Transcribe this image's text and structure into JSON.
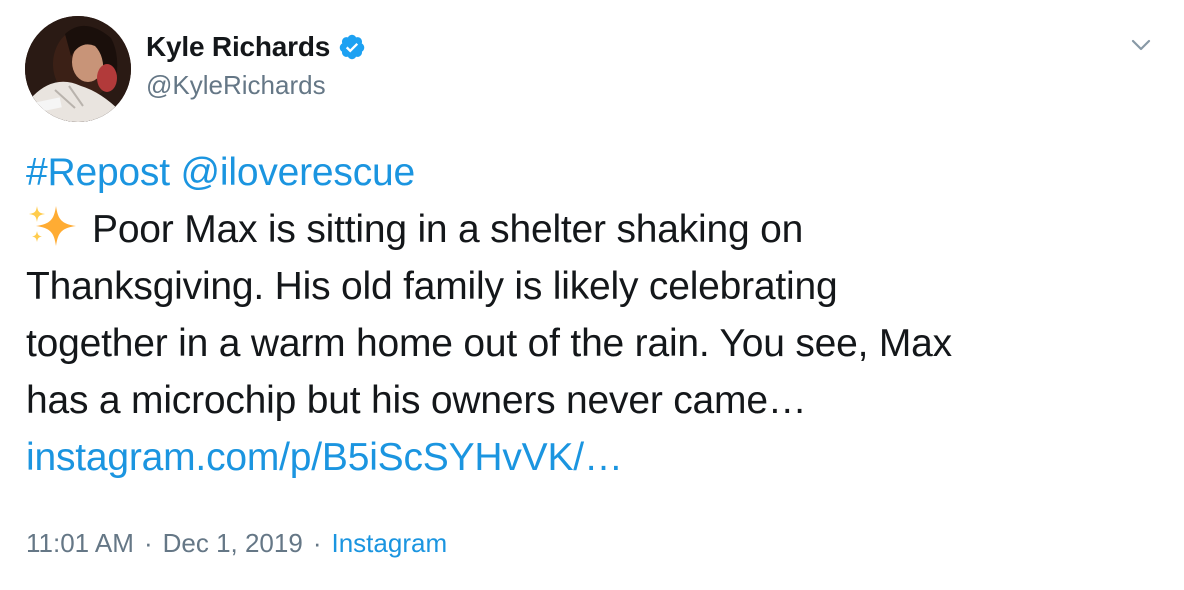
{
  "author": {
    "display_name": "Kyle Richards",
    "handle": "@KyleRichards",
    "verified": true,
    "avatar_icon": "profile-photo"
  },
  "menu": {
    "icon": "chevron-down-icon"
  },
  "tweet": {
    "hashtag": "#Repost",
    "mention": "@iloverescue",
    "emoji_icon": "sparkles-icon",
    "line1_text": "Poor Max is sitting in a shelter shaking on",
    "line2_text": "Thanksgiving. His old family is likely celebrating",
    "line3_text": "together in a warm home out of the rain. You see, Max",
    "line4_text": "has a microchip but his owners never came…",
    "link_text": "instagram.com/p/B5iScSYHvVK/…"
  },
  "meta": {
    "time": "11:01 AM",
    "separator": "·",
    "date": "Dec 1, 2019",
    "source": "Instagram"
  },
  "colors": {
    "link": "#1b95e0",
    "secondary_text": "#657786",
    "primary_text": "#14171a",
    "verified_badge": "#1da1f2",
    "sparkle": "#ffac33"
  }
}
